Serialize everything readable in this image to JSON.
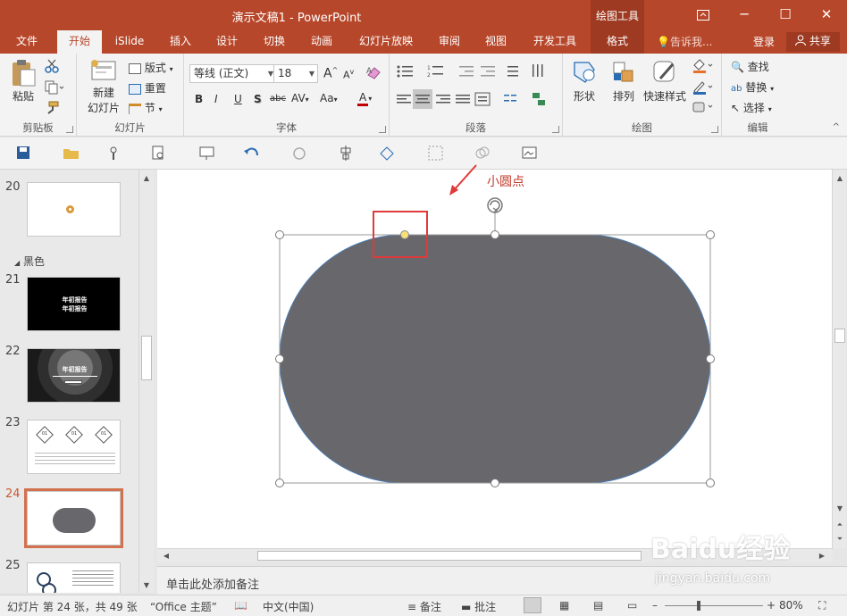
{
  "window": {
    "title": "演示文稿1 - PowerPoint",
    "context_tools": "绘图工具",
    "ribbon_display_icon": "ribbon-display-icon",
    "minimize": "─",
    "maximize": "☐",
    "close": "✕"
  },
  "tabs": [
    {
      "label": "文件"
    },
    {
      "label": "开始"
    },
    {
      "label": "iSlide"
    },
    {
      "label": "插入"
    },
    {
      "label": "设计"
    },
    {
      "label": "切换"
    },
    {
      "label": "动画"
    },
    {
      "label": "幻灯片放映"
    },
    {
      "label": "审阅"
    },
    {
      "label": "视图"
    },
    {
      "label": "开发工具"
    },
    {
      "label": "格式"
    }
  ],
  "tell_me": "告诉我...",
  "login": "登录",
  "share": "共享",
  "ribbon": {
    "clipboard": {
      "paste": "粘贴",
      "label": "剪贴板"
    },
    "slides": {
      "new_slide_line1": "新建",
      "new_slide_line2": "幻灯片",
      "layout": "版式",
      "reset": "重置",
      "section": "节",
      "label": "幻灯片"
    },
    "font": {
      "font_name": "等线 (正文)",
      "font_size": "18",
      "label": "字体",
      "bold": "B",
      "italic": "I",
      "underline": "U",
      "shadow": "S",
      "strike": "abc",
      "spacing": "AV",
      "case": "Aa",
      "color": "A",
      "grow": "A",
      "shrink": "A"
    },
    "paragraph": {
      "label": "段落"
    },
    "drawing": {
      "shape": "形状",
      "arrange": "排列",
      "quick_styles": "快速样式",
      "label": "绘图"
    },
    "editing": {
      "find": "查找",
      "replace": "替换",
      "select": "选择",
      "label": "编辑"
    }
  },
  "thumbnails": [
    {
      "number": "20"
    },
    {
      "number": "21",
      "line1": "年初报告",
      "line2": "年初报告"
    },
    {
      "number": "22",
      "line1": "年初报告"
    },
    {
      "number": "23",
      "labels": [
        "01",
        "01",
        "01"
      ]
    },
    {
      "number": "24"
    },
    {
      "number": "25"
    }
  ],
  "section_name": "黑色",
  "annotation": "小圆点",
  "notes_placeholder": "单击此处添加备注",
  "status": {
    "slide_info": "幻灯片 第 24 张，共 49 张",
    "theme": "“Office 主题”",
    "language": "中文(中国)",
    "notes": "备注",
    "comments": "批注",
    "zoom": "80%"
  },
  "watermark": {
    "text": "Baidu经验",
    "url_text": "jingyan.baidu.com"
  },
  "colors": {
    "accent": "#b7472a",
    "shape_fill": "#68676b",
    "selected_thumb": "#d2714d",
    "annotation": "#c0392b"
  }
}
